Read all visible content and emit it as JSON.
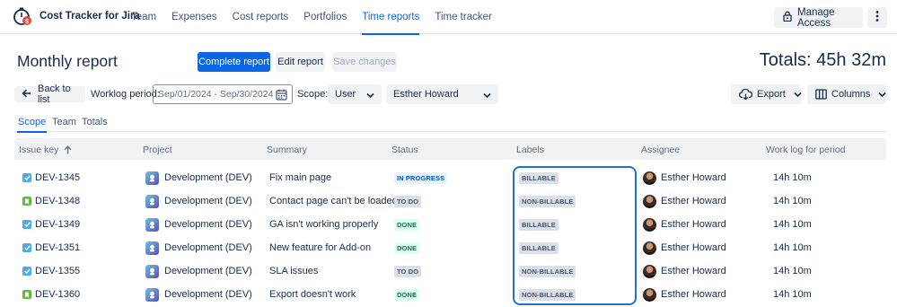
{
  "app": {
    "name": "Cost Tracker for Jira",
    "nav": [
      {
        "label": "Team",
        "active": false
      },
      {
        "label": "Expenses",
        "active": false
      },
      {
        "label": "Cost reports",
        "active": false
      },
      {
        "label": "Portfolios",
        "active": false
      },
      {
        "label": "Time reports",
        "active": true
      },
      {
        "label": "Time tracker",
        "active": false
      }
    ],
    "manage_access": "Manage Access"
  },
  "header": {
    "title": "Monthly report",
    "complete_report": "Complete report",
    "edit_report": "Edit report",
    "save_changes": "Save changes",
    "totals": "Totals: 45h 32m"
  },
  "filters": {
    "back": "Back to list",
    "worklog_label": "Worklog period:",
    "worklog_value": "Sep/01/2024 - Sep/30/2024",
    "scope_label": "Scope:",
    "scope_value": "User",
    "user_value": "Esther Howard",
    "export": "Export",
    "columns": "Columns"
  },
  "tabs": [
    {
      "label": "Scope",
      "active": true
    },
    {
      "label": "Team",
      "active": false
    },
    {
      "label": "Totals",
      "active": false
    }
  ],
  "table": {
    "columns": [
      "Issue key",
      "Project",
      "Summary",
      "Status",
      "Labels",
      "Assignee",
      "Work log for period"
    ],
    "rows": [
      {
        "key": "DEV-1345",
        "type": "task",
        "project": "Development (DEV)",
        "summary": "Fix main page",
        "status": "IN PROGRESS",
        "label": "BILLABLE",
        "assignee": "Esther Howard",
        "worklog": "14h 10m"
      },
      {
        "key": "DEV-1348",
        "type": "story",
        "project": "Development (DEV)",
        "summary": "Contact page can't be loaded",
        "status": "TO DO",
        "label": "NON-BILLABLE",
        "assignee": "Esther Howard",
        "worklog": "14h 10m"
      },
      {
        "key": "DEV-1349",
        "type": "task",
        "project": "Development (DEV)",
        "summary": "GA isn't working properly",
        "status": "DONE",
        "label": "BILLABLE",
        "assignee": "Esther Howard",
        "worklog": "14h 10m"
      },
      {
        "key": "DEV-1351",
        "type": "task",
        "project": "Development (DEV)",
        "summary": "New feature for Add-on",
        "status": "DONE",
        "label": "BILLABLE",
        "assignee": "Esther Howard",
        "worklog": "14h 10m"
      },
      {
        "key": "DEV-1355",
        "type": "task",
        "project": "Development (DEV)",
        "summary": "SLA issues",
        "status": "TO DO",
        "label": "NON-BILLABLE",
        "assignee": "Esther Howard",
        "worklog": "14h 10m"
      },
      {
        "key": "DEV-1360",
        "type": "story",
        "project": "Development (DEV)",
        "summary": "Export doesn't work",
        "status": "DONE",
        "label": "NON-BILLABLE",
        "assignee": "Esther Howard",
        "worklog": "14h 10m"
      }
    ]
  },
  "colors": {
    "primary": "#0c66e4",
    "in_progress_bg": "#e9f2ff",
    "in_progress_fg": "#0055cc",
    "todo_bg": "#dcdfe4",
    "todo_fg": "#44546f",
    "done_bg": "#dcfff1",
    "done_fg": "#216e4e",
    "label_bg": "#dcdfe4",
    "task_icon": "#4bade8",
    "story_icon": "#63ba3c"
  },
  "icons": {
    "logo": "stopwatch-logo-icon",
    "lock": "lock-icon",
    "kebab": "more-vertical-icon",
    "back": "arrow-left-icon",
    "calendar": "calendar-icon",
    "chevron": "chevron-down-icon",
    "export": "cloud-download-icon",
    "columns": "columns-icon",
    "sort": "arrow-up-icon"
  }
}
